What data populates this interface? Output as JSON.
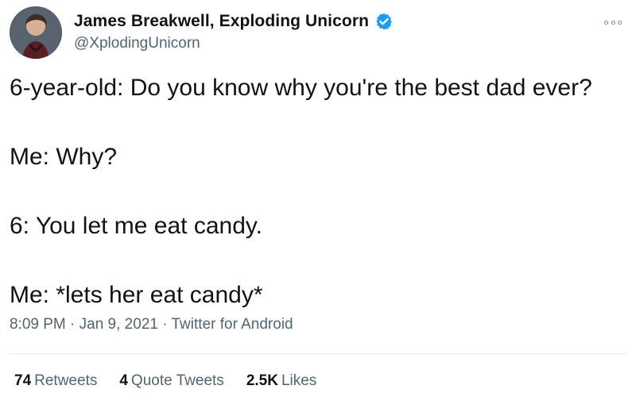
{
  "tweet": {
    "author": {
      "display_name": "James Breakwell, Exploding Unicorn",
      "handle": "@XplodingUnicorn",
      "verified_icon": "verified-badge-icon"
    },
    "menu_icon": "more-options-icon",
    "text_lines": [
      "6-year-old: Do you know why you're the best dad ever?",
      "Me: Why?",
      "6: You let me eat candy.",
      "Me: *lets her eat candy*"
    ],
    "meta": {
      "text": "8:09 PM · Jan 9, 2021 · Twitter for Android"
    },
    "stats": [
      {
        "value": "74",
        "label": "Retweets"
      },
      {
        "value": "4",
        "label": "Quote Tweets"
      },
      {
        "value": "2.5K",
        "label": "Likes"
      }
    ]
  },
  "colors": {
    "primary_text": "#0f1419",
    "secondary_text": "#536471",
    "verified_blue": "#1d9bf0",
    "divider": "#e7ecef"
  }
}
